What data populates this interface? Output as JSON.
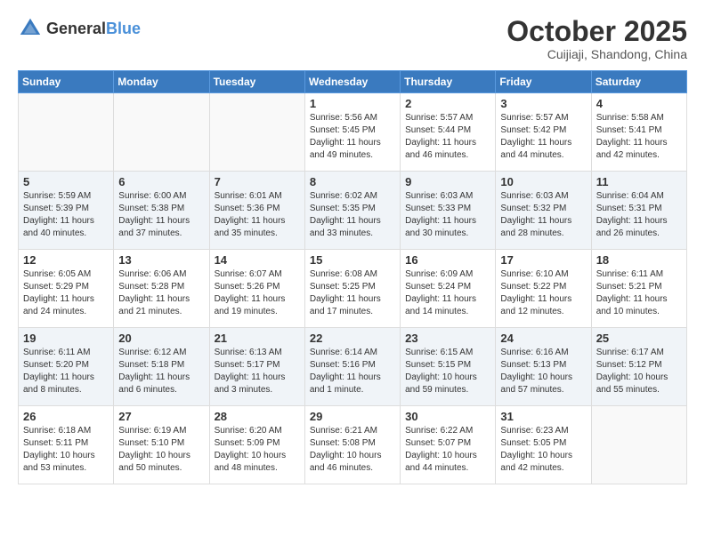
{
  "header": {
    "logo_general": "General",
    "logo_blue": "Blue",
    "month_title": "October 2025",
    "location": "Cuijiaji, Shandong, China"
  },
  "weekdays": [
    "Sunday",
    "Monday",
    "Tuesday",
    "Wednesday",
    "Thursday",
    "Friday",
    "Saturday"
  ],
  "weeks": [
    [
      {
        "day": "",
        "info": ""
      },
      {
        "day": "",
        "info": ""
      },
      {
        "day": "",
        "info": ""
      },
      {
        "day": "1",
        "info": "Sunrise: 5:56 AM\nSunset: 5:45 PM\nDaylight: 11 hours\nand 49 minutes."
      },
      {
        "day": "2",
        "info": "Sunrise: 5:57 AM\nSunset: 5:44 PM\nDaylight: 11 hours\nand 46 minutes."
      },
      {
        "day": "3",
        "info": "Sunrise: 5:57 AM\nSunset: 5:42 PM\nDaylight: 11 hours\nand 44 minutes."
      },
      {
        "day": "4",
        "info": "Sunrise: 5:58 AM\nSunset: 5:41 PM\nDaylight: 11 hours\nand 42 minutes."
      }
    ],
    [
      {
        "day": "5",
        "info": "Sunrise: 5:59 AM\nSunset: 5:39 PM\nDaylight: 11 hours\nand 40 minutes."
      },
      {
        "day": "6",
        "info": "Sunrise: 6:00 AM\nSunset: 5:38 PM\nDaylight: 11 hours\nand 37 minutes."
      },
      {
        "day": "7",
        "info": "Sunrise: 6:01 AM\nSunset: 5:36 PM\nDaylight: 11 hours\nand 35 minutes."
      },
      {
        "day": "8",
        "info": "Sunrise: 6:02 AM\nSunset: 5:35 PM\nDaylight: 11 hours\nand 33 minutes."
      },
      {
        "day": "9",
        "info": "Sunrise: 6:03 AM\nSunset: 5:33 PM\nDaylight: 11 hours\nand 30 minutes."
      },
      {
        "day": "10",
        "info": "Sunrise: 6:03 AM\nSunset: 5:32 PM\nDaylight: 11 hours\nand 28 minutes."
      },
      {
        "day": "11",
        "info": "Sunrise: 6:04 AM\nSunset: 5:31 PM\nDaylight: 11 hours\nand 26 minutes."
      }
    ],
    [
      {
        "day": "12",
        "info": "Sunrise: 6:05 AM\nSunset: 5:29 PM\nDaylight: 11 hours\nand 24 minutes."
      },
      {
        "day": "13",
        "info": "Sunrise: 6:06 AM\nSunset: 5:28 PM\nDaylight: 11 hours\nand 21 minutes."
      },
      {
        "day": "14",
        "info": "Sunrise: 6:07 AM\nSunset: 5:26 PM\nDaylight: 11 hours\nand 19 minutes."
      },
      {
        "day": "15",
        "info": "Sunrise: 6:08 AM\nSunset: 5:25 PM\nDaylight: 11 hours\nand 17 minutes."
      },
      {
        "day": "16",
        "info": "Sunrise: 6:09 AM\nSunset: 5:24 PM\nDaylight: 11 hours\nand 14 minutes."
      },
      {
        "day": "17",
        "info": "Sunrise: 6:10 AM\nSunset: 5:22 PM\nDaylight: 11 hours\nand 12 minutes."
      },
      {
        "day": "18",
        "info": "Sunrise: 6:11 AM\nSunset: 5:21 PM\nDaylight: 11 hours\nand 10 minutes."
      }
    ],
    [
      {
        "day": "19",
        "info": "Sunrise: 6:11 AM\nSunset: 5:20 PM\nDaylight: 11 hours\nand 8 minutes."
      },
      {
        "day": "20",
        "info": "Sunrise: 6:12 AM\nSunset: 5:18 PM\nDaylight: 11 hours\nand 6 minutes."
      },
      {
        "day": "21",
        "info": "Sunrise: 6:13 AM\nSunset: 5:17 PM\nDaylight: 11 hours\nand 3 minutes."
      },
      {
        "day": "22",
        "info": "Sunrise: 6:14 AM\nSunset: 5:16 PM\nDaylight: 11 hours\nand 1 minute."
      },
      {
        "day": "23",
        "info": "Sunrise: 6:15 AM\nSunset: 5:15 PM\nDaylight: 10 hours\nand 59 minutes."
      },
      {
        "day": "24",
        "info": "Sunrise: 6:16 AM\nSunset: 5:13 PM\nDaylight: 10 hours\nand 57 minutes."
      },
      {
        "day": "25",
        "info": "Sunrise: 6:17 AM\nSunset: 5:12 PM\nDaylight: 10 hours\nand 55 minutes."
      }
    ],
    [
      {
        "day": "26",
        "info": "Sunrise: 6:18 AM\nSunset: 5:11 PM\nDaylight: 10 hours\nand 53 minutes."
      },
      {
        "day": "27",
        "info": "Sunrise: 6:19 AM\nSunset: 5:10 PM\nDaylight: 10 hours\nand 50 minutes."
      },
      {
        "day": "28",
        "info": "Sunrise: 6:20 AM\nSunset: 5:09 PM\nDaylight: 10 hours\nand 48 minutes."
      },
      {
        "day": "29",
        "info": "Sunrise: 6:21 AM\nSunset: 5:08 PM\nDaylight: 10 hours\nand 46 minutes."
      },
      {
        "day": "30",
        "info": "Sunrise: 6:22 AM\nSunset: 5:07 PM\nDaylight: 10 hours\nand 44 minutes."
      },
      {
        "day": "31",
        "info": "Sunrise: 6:23 AM\nSunset: 5:05 PM\nDaylight: 10 hours\nand 42 minutes."
      },
      {
        "day": "",
        "info": ""
      }
    ]
  ]
}
